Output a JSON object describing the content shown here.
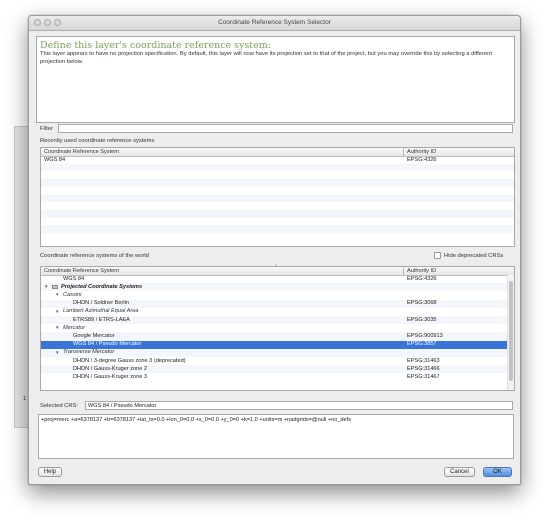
{
  "window": {
    "title": "Coordinate Reference System Selector"
  },
  "info": {
    "heading": "Define this layer's coordinate reference system:",
    "text": "This layer appears to have no projection specification. By default, this layer will now have its projection set to that of the project, but you may override this by selecting a different projection below."
  },
  "filter": {
    "label": "Filter",
    "value": ""
  },
  "recent": {
    "label": "Recently used coordinate reference systems",
    "columns": [
      "Coordinate Reference System",
      "Authority ID"
    ],
    "rows": [
      {
        "name": "WGS 84",
        "id": "EPSG:4326"
      }
    ]
  },
  "world": {
    "label": "Coordinate reference systems of the world",
    "hide_deprecated_label": "Hide deprecated CRSs",
    "columns": [
      "Coordinate Reference System",
      "Authority ID"
    ],
    "rows": [
      {
        "name": "WGS 84",
        "id": "EPSG:4326",
        "type": "item",
        "level": 1
      },
      {
        "name": "Projected Coordinate Systems",
        "id": "",
        "type": "root",
        "level": 0
      },
      {
        "name": "Cassini",
        "id": "",
        "type": "group",
        "level": 1
      },
      {
        "name": "DHDN / Soldner Berlin",
        "id": "EPSG:3068",
        "type": "item",
        "level": 2
      },
      {
        "name": "Lambert Azimuthal Equal Area",
        "id": "",
        "type": "group",
        "level": 1
      },
      {
        "name": "ETRS89 / ETRS-LAEA",
        "id": "EPSG:3035",
        "type": "item",
        "level": 2
      },
      {
        "name": "Mercator",
        "id": "",
        "type": "group",
        "level": 1
      },
      {
        "name": "Google Mercator",
        "id": "EPSG:900913",
        "type": "item",
        "level": 2
      },
      {
        "name": "WGS 84 / Pseudo Mercator",
        "id": "EPSG:3857",
        "type": "item",
        "level": 2,
        "selected": true
      },
      {
        "name": "Transverse Mercator",
        "id": "",
        "type": "group",
        "level": 1
      },
      {
        "name": "DHDN / 3-degree Gauss zone 3 (deprecated)",
        "id": "EPSG:31463",
        "type": "item",
        "level": 2
      },
      {
        "name": "DHDN / Gauss-Kruger zone 2",
        "id": "EPSG:31466",
        "type": "item",
        "level": 2
      },
      {
        "name": "DHDN / Gauss-Kruger zone 3",
        "id": "EPSG:31467",
        "type": "item",
        "level": 2
      }
    ]
  },
  "selected": {
    "label": "Selected CRS:",
    "value": "WGS 84 / Pseudo Mercator"
  },
  "proj": {
    "text": "+proj=merc +a=6378137 +b=6378137 +lat_ts=0.0 +lon_0=0.0 +x_0=0.0 +y_0=0 +k=1.0 +units=m +nadgrids=@null +no_defs"
  },
  "buttons": {
    "help": "Help",
    "cancel": "Cancel",
    "ok": "OK"
  },
  "background": {
    "fragment": "1"
  },
  "colors": {
    "accent": "#3875d7",
    "heading": "#7aa25a",
    "window_bg": "#ededed"
  }
}
